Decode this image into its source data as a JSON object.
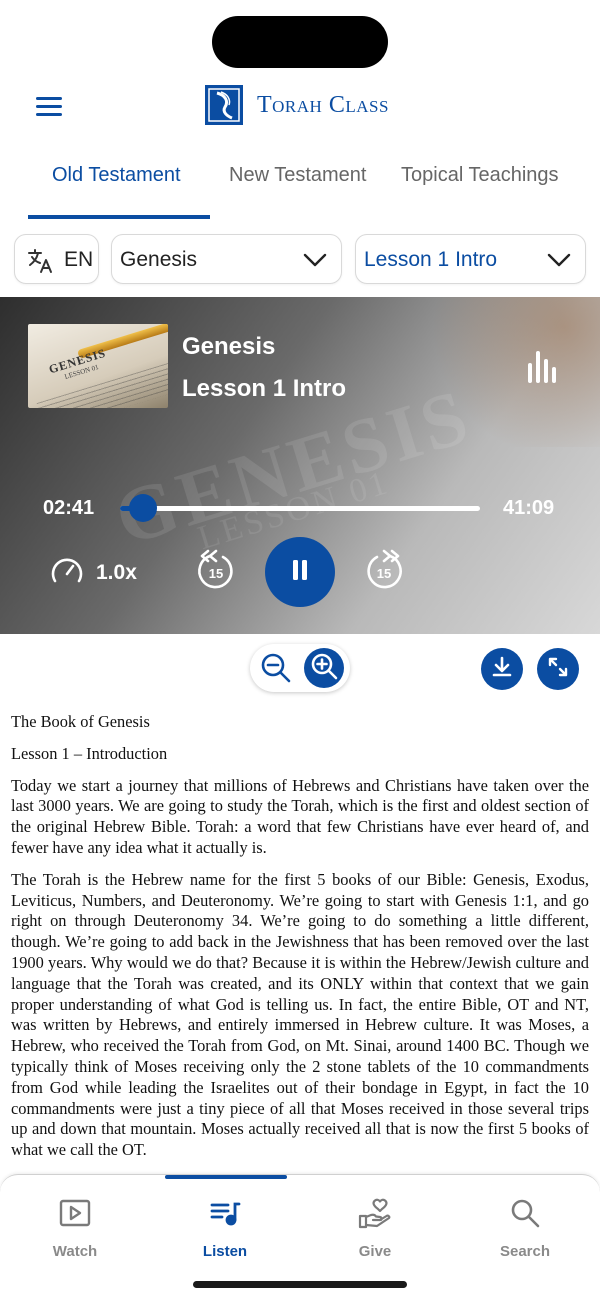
{
  "app": {
    "brand_name": "Torah Class",
    "brand_color": "#0b4da2"
  },
  "tabs": [
    {
      "label": "Old Testament",
      "active": true
    },
    {
      "label": "New Testament",
      "active": false
    },
    {
      "label": "Topical Teachings",
      "active": false
    }
  ],
  "selectors": {
    "language": "EN",
    "book": "Genesis",
    "lesson": "Lesson 1 Intro"
  },
  "player": {
    "thumbnail_title": "GENESIS",
    "thumbnail_subtitle": "LESSON 01",
    "title": "Genesis",
    "subtitle": "Lesson 1 Intro",
    "elapsed": "02:41",
    "duration": "41:09",
    "progress_fraction": 0.065,
    "speed": "1.0x",
    "skip_back_seconds": "15",
    "skip_forward_seconds": "15",
    "state": "playing"
  },
  "document": {
    "title": "The Book of Genesis",
    "subtitle": "Lesson 1 – Introduction",
    "paragraphs": [
      "Today we start a journey that millions of Hebrews and Christians have taken over the last 3000 years. We are going to study the Torah, which is the first and oldest section of the original Hebrew Bible. Torah: a word that few Christians have ever heard of, and fewer have any idea what it actually is.",
      "The Torah is the Hebrew name for the first 5 books of our Bible: Genesis, Exodus, Leviticus, Numbers, and Deuteronomy. We’re going to start with Genesis 1:1, and go right on through Deuteronomy 34. We’re going to do something a little different, though. We’re going to add back in the Jewishness that has been removed over the last 1900 years. Why would we do that? Because it is within the Hebrew/Jewish culture and language that the Torah was created, and its ONLY within that context that we gain proper understanding of what God is telling us. In fact, the entire Bible, OT and NT, was written by Hebrews, and entirely immersed in Hebrew culture. It was Moses, a Hebrew, who received the Torah from God, on Mt. Sinai, around 1400 BC. Though we typically think of Moses receiving only the 2 stone tablets of the 10 commandments from God while leading the Israelites out of their bondage in Egypt, in fact the 10 commandments were just a tiny piece of all that Moses received in those several trips up and down that mountain. Moses actually received all that is now the first 5 books of what we call the OT."
    ]
  },
  "bottom_nav": [
    {
      "label": "Watch",
      "icon": "play-square-icon",
      "active": false
    },
    {
      "label": "Listen",
      "icon": "playlist-music-icon",
      "active": true
    },
    {
      "label": "Give",
      "icon": "hand-heart-icon",
      "active": false
    },
    {
      "label": "Search",
      "icon": "search-icon",
      "active": false
    }
  ]
}
